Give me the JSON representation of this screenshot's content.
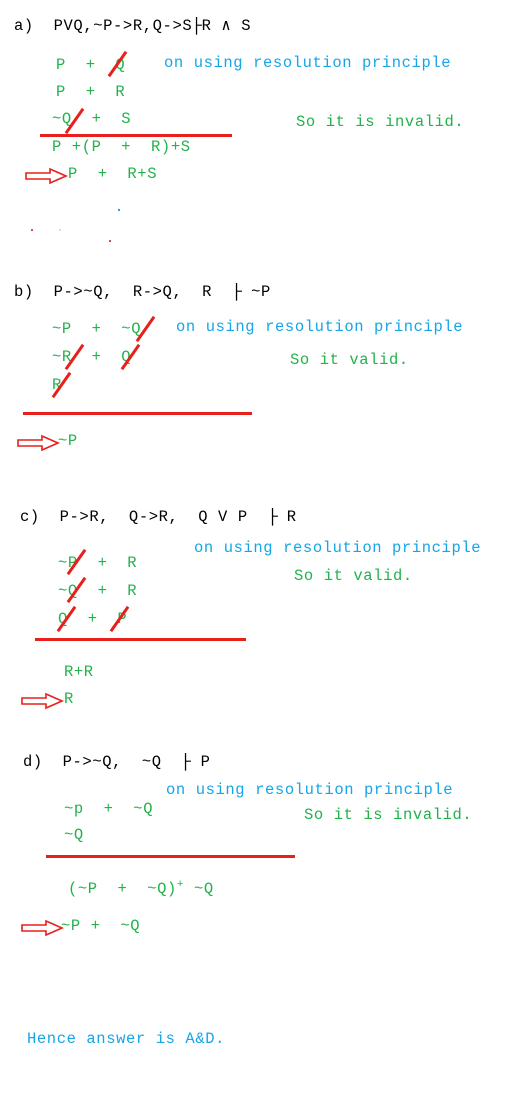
{
  "page": {
    "background": "#ffffff",
    "text_black": "#000000",
    "text_green": "#21b24b",
    "text_blue": "#15a5e8",
    "mark_red": "#e8201b"
  },
  "sections": [
    {
      "id": "a",
      "label": "a)",
      "premise_line": "PVQ,~P->R,Q->S",
      "turnstile": "├",
      "conclusion": "R ∧ S",
      "note_blue": "on using resolution principle",
      "note_green": "So it is invalid.",
      "clauses": [
        "P  +  Q",
        "P  +  R",
        "~Q  +  S"
      ],
      "derived": [
        "P +(P  +  R)+S"
      ],
      "result": "P  +  R+S"
    },
    {
      "id": "b",
      "label": "b)",
      "premise_line": "P->~Q,  R->Q,  R",
      "turnstile": "├",
      "conclusion": "~P",
      "note_blue": "on using resolution principle",
      "note_green": "So it valid.",
      "clauses": [
        "~P  +  ~Q",
        "~R  +  Q",
        "R"
      ],
      "derived": [],
      "result": "~P"
    },
    {
      "id": "c",
      "label": "c)",
      "premise_line": "P->R,  Q->R,  Q V P",
      "turnstile": "├",
      "conclusion": "R",
      "note_blue": "on using resolution principle",
      "note_green": "So it valid.",
      "clauses": [
        "~P  +  R",
        "~Q  +  R",
        "Q  +  P"
      ],
      "derived": [
        "R+R"
      ],
      "result": "R"
    },
    {
      "id": "d",
      "label": "d)",
      "premise_line": "P->~Q,  ~Q",
      "turnstile": "├",
      "conclusion": "P",
      "note_blue": "on using resolution principle",
      "note_green": "So it is invalid.",
      "clauses": [
        "~p  +  ~Q",
        "~Q"
      ],
      "derived_prefix": "(~P  +  ~Q)",
      "derived_sup": "+",
      "derived_suffix": " ~Q",
      "result": "~P +  ~Q"
    }
  ],
  "footer": {
    "text": "Hence answer is A&D."
  }
}
